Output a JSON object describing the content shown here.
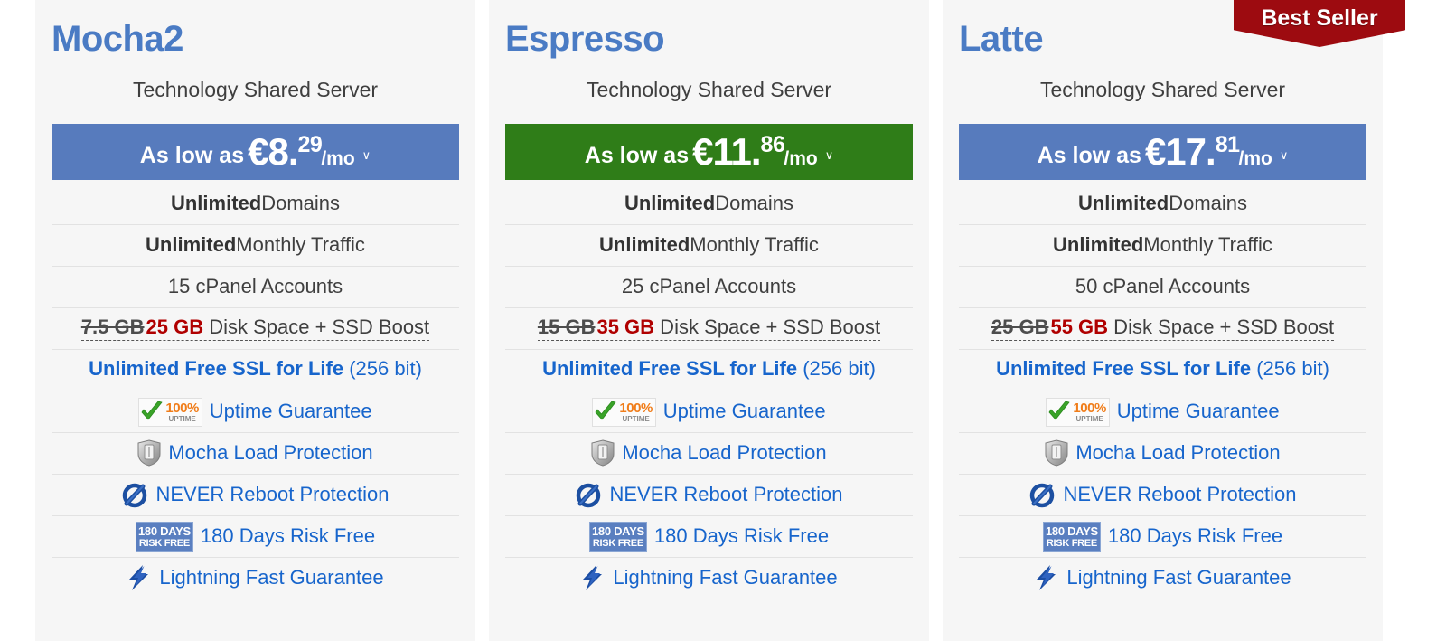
{
  "colors": {
    "card_bg": "#f6f6f6",
    "plan_name": "#4a7bc4",
    "banner_blue": "#577bbd",
    "banner_green": "#2f7d18",
    "link_blue": "#1765cc",
    "sale_red": "#b00000",
    "ribbon_red": "#9d0b10"
  },
  "ribbon": {
    "label": "Best Seller"
  },
  "icons": {
    "uptime": "check-uptime-icon",
    "shield": "shield-icon",
    "reboot": "no-reboot-icon",
    "risk": "180-days-risk-free-icon",
    "lightning": "lightning-bolt-icon",
    "caret": "chevron-down-icon"
  },
  "labels": {
    "as_low_as": "As low as",
    "per_mo": "/mo",
    "caret": "∨",
    "uptime_100": "100%",
    "uptime_word": "UPTIME",
    "risk_line1": "180 DAYS",
    "risk_line2": "RISK FREE"
  },
  "plans": [
    {
      "name": "Mocha2",
      "subtitle": "Technology Shared Server",
      "banner_color": "#577bbd",
      "best_seller": false,
      "price": {
        "currency": "€",
        "whole": "8.",
        "cents": "29",
        "per": "/mo"
      },
      "features": {
        "domains_qty": "Unlimited",
        "domains_text": " Domains",
        "traffic_qty": "Unlimited",
        "traffic_text": " Monthly Traffic",
        "cpanel": "15 cPanel Accounts",
        "disk_old": "7.5 GB",
        "disk_new": "25 GB",
        "disk_text": " Disk Space + SSD Boost",
        "ssl_bold": "Unlimited Free SSL for Life",
        "ssl_rest": " (256 bit)",
        "uptime": "Uptime Guarantee",
        "load": "Mocha Load Protection",
        "reboot": "NEVER Reboot Protection",
        "risk": "180 Days Risk Free",
        "lightning": "Lightning Fast Guarantee"
      }
    },
    {
      "name": "Espresso",
      "subtitle": "Technology Shared Server",
      "banner_color": "#2f7d18",
      "best_seller": false,
      "price": {
        "currency": "€",
        "whole": "11.",
        "cents": "86",
        "per": "/mo"
      },
      "features": {
        "domains_qty": "Unlimited",
        "domains_text": " Domains",
        "traffic_qty": "Unlimited",
        "traffic_text": " Monthly Traffic",
        "cpanel": "25 cPanel Accounts",
        "disk_old": "15 GB",
        "disk_new": "35 GB",
        "disk_text": " Disk Space + SSD Boost",
        "ssl_bold": "Unlimited Free SSL for Life",
        "ssl_rest": " (256 bit)",
        "uptime": "Uptime Guarantee",
        "load": "Mocha Load Protection",
        "reboot": "NEVER Reboot Protection",
        "risk": "180 Days Risk Free",
        "lightning": "Lightning Fast Guarantee"
      }
    },
    {
      "name": "Latte",
      "subtitle": "Technology Shared Server",
      "banner_color": "#577bbd",
      "best_seller": true,
      "price": {
        "currency": "€",
        "whole": "17.",
        "cents": "81",
        "per": "/mo"
      },
      "features": {
        "domains_qty": "Unlimited",
        "domains_text": " Domains",
        "traffic_qty": "Unlimited",
        "traffic_text": " Monthly Traffic",
        "cpanel": "50 cPanel Accounts",
        "disk_old": "25 GB",
        "disk_new": "55 GB",
        "disk_text": " Disk Space + SSD Boost",
        "ssl_bold": "Unlimited Free SSL for Life",
        "ssl_rest": " (256 bit)",
        "uptime": "Uptime Guarantee",
        "load": "Mocha Load Protection",
        "reboot": "NEVER Reboot Protection",
        "risk": "180 Days Risk Free",
        "lightning": "Lightning Fast Guarantee"
      }
    }
  ]
}
